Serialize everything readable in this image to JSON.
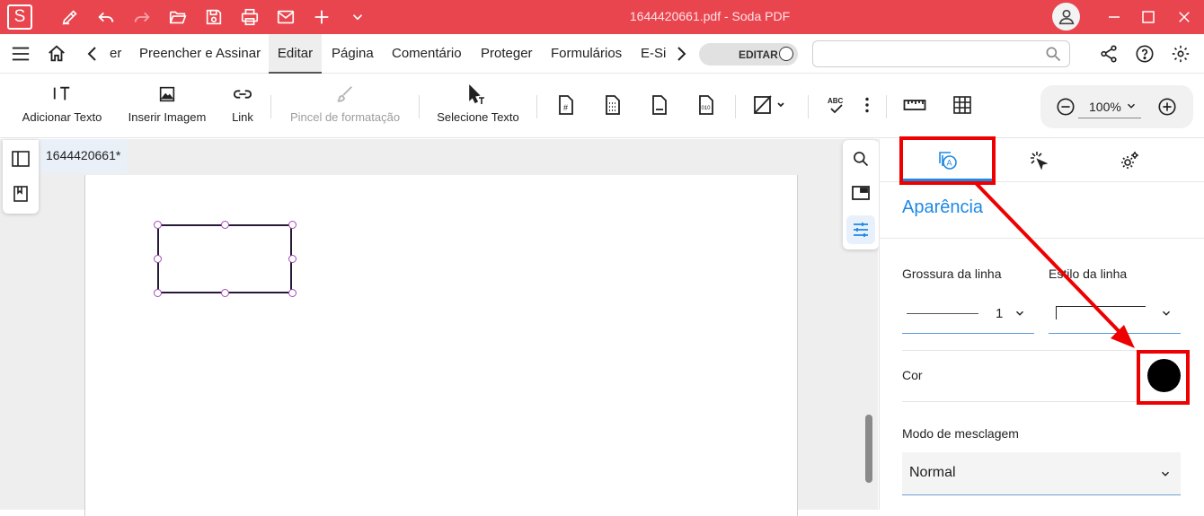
{
  "app": {
    "logo_letter": "S",
    "window_title": "1644420661.pdf  -  Soda PDF",
    "accent_color": "#e9454f"
  },
  "menu": {
    "partial_left_tab": "er",
    "tabs": [
      {
        "label": "Preencher e Assinar"
      },
      {
        "label": "Editar"
      },
      {
        "label": "Página"
      },
      {
        "label": "Comentário"
      },
      {
        "label": "Proteger"
      },
      {
        "label": "Formulários"
      },
      {
        "label": "E-Si"
      }
    ],
    "active_tab": "Editar",
    "edit_toggle_label": "EDITAR",
    "search_value": ""
  },
  "toolbar": {
    "add_text": "Adicionar Texto",
    "insert_image": "Inserir Imagem",
    "link": "Link",
    "format_painter": "Pincel de formatação",
    "select_text": "Selecione Texto",
    "zoom_value": "100%"
  },
  "document": {
    "tab_title": "1644420661*"
  },
  "panel": {
    "heading": "Aparência",
    "line_width_label": "Grossura da linha",
    "line_width_value": "1",
    "line_style_label": "Estilo da linha",
    "color_label": "Cor",
    "color_value": "#000000",
    "blend_mode_label": "Modo de mesclagem",
    "blend_mode_value": "Normal",
    "active_tab_color": "#1e88e5"
  },
  "annotation": {
    "highlight_color": "#ee0000"
  }
}
